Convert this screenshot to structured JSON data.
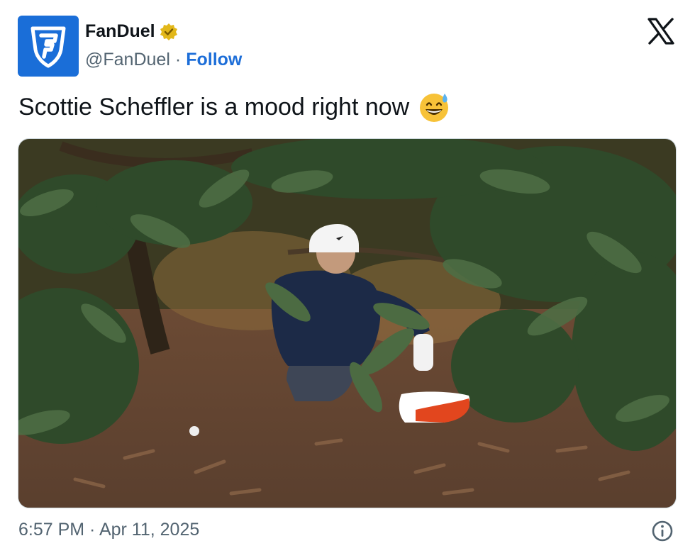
{
  "account": {
    "display_name": "FanDuel",
    "handle": "@FanDuel",
    "separator": "·",
    "follow_label": "Follow",
    "verified_icon": "gold-verified-badge-icon",
    "avatar_icon": "fanduel-shield-logo-icon"
  },
  "platform": {
    "logo_icon": "x-logo-icon"
  },
  "tweet": {
    "text": "Scottie Scheffler is a mood right now",
    "emoji_icon": "grinning-face-with-sweat-emoji-icon"
  },
  "media": {
    "kind": "photo",
    "subject": "golfer kneeling under a magnolia tree beside a golf ball"
  },
  "footer": {
    "timestamp": "6:57 PM · Apr 11, 2025",
    "info_icon": "info-icon"
  },
  "colors": {
    "brand_blue": "#1a6ed8",
    "link_blue": "#1d6ed8",
    "verified_gold": "#e2b719",
    "muted_text": "#536471"
  }
}
